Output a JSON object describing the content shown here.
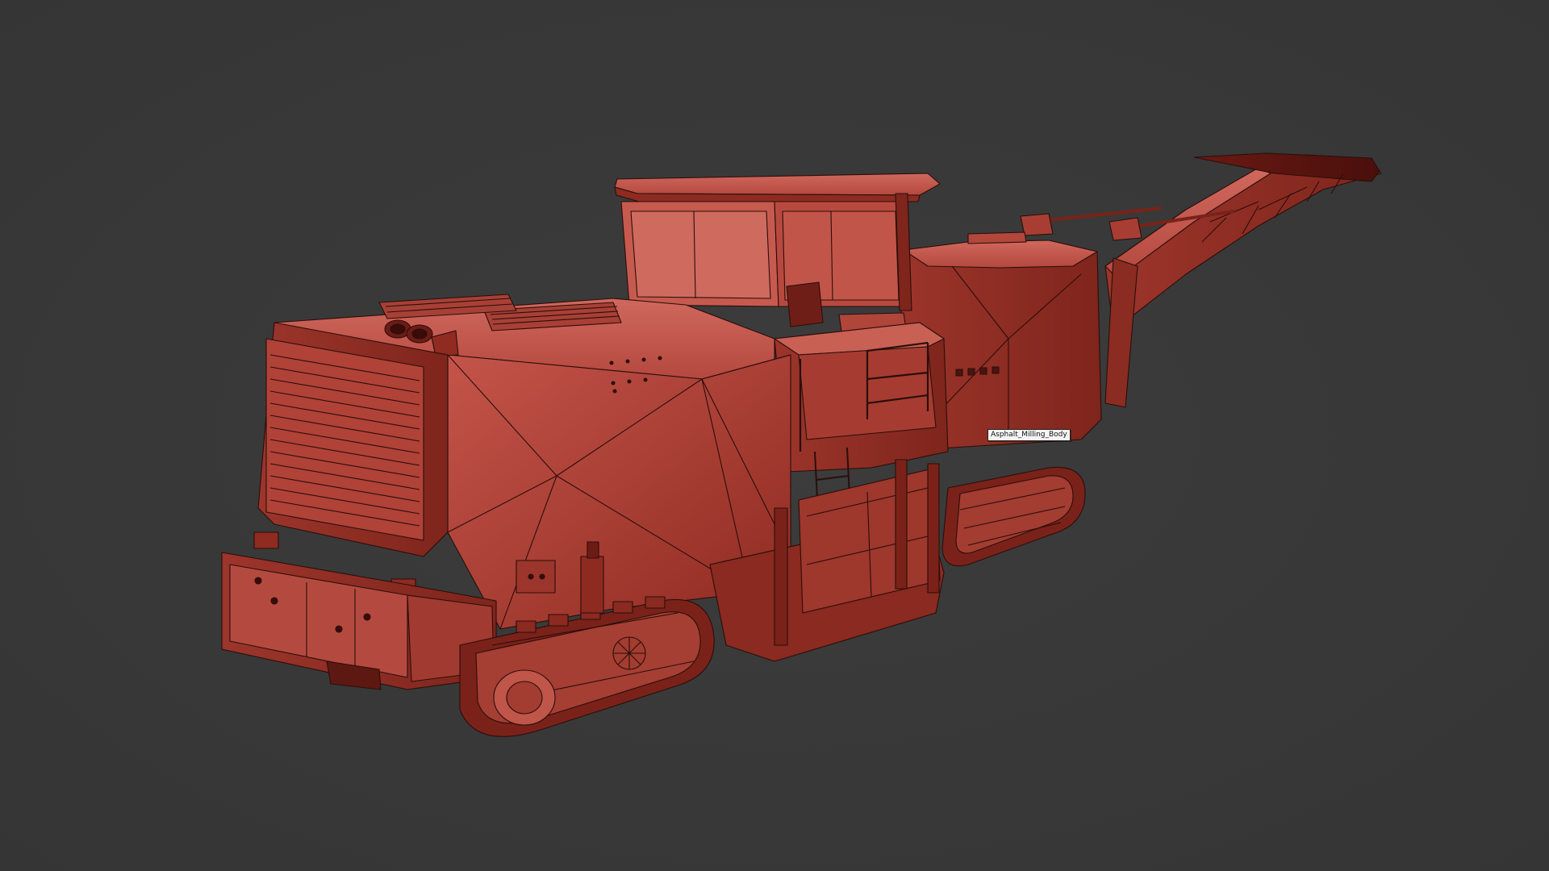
{
  "viewport": {
    "background_color": "#3a3a3a",
    "shading": "wireframe-on-shaded",
    "object_color": "#b8473c",
    "edge_color": "#2a0e0b"
  },
  "hover_tooltip": {
    "label": "Asphalt_Milling_Body"
  }
}
